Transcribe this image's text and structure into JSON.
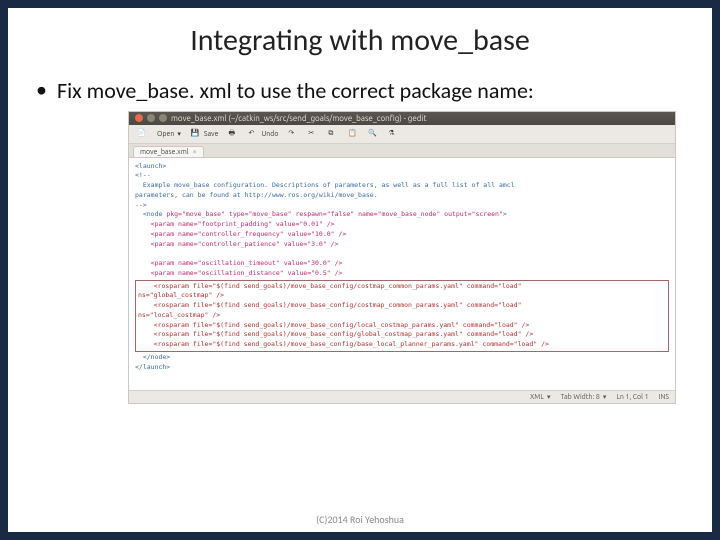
{
  "title": "Integrating with move_base",
  "bullet": "Fix move_base. xml to use the correct package name:",
  "footer": "(C)2014 Roi Yehoshua",
  "window": {
    "title": "move_base.xml (~/catkin_ws/src/send_goals/move_base_config) - gedit",
    "tab": "move_base.xml",
    "tab_close": "×"
  },
  "toolbar": {
    "open": "Open",
    "save": "Save",
    "undo": "Undo"
  },
  "code": {
    "l1a": "<launch>",
    "l2a": "<!--",
    "l2b": "Example move_base configuration. Descriptions of parameters, as well as a full list of all amcl",
    "l2c": "parameters, can be found at http://www.ros.org/wiki/move_base.",
    "l2d": "-->",
    "l3_open": "<node ",
    "l3_attrs": "pkg=\"move_base\" type=\"move_base\" respawn=\"false\" name=\"move_base_node\" output=\"screen\"",
    "l3_close": ">",
    "p1": "<param name=\"footprint_padding\" value=\"0.01\" />",
    "p2": "<param name=\"controller_frequency\" value=\"10.0\" />",
    "p3": "<param name=\"controller_patience\" value=\"3.0\" />",
    "p4": "<param name=\"oscillation_timeout\" value=\"30.0\" />",
    "p5": "<param name=\"oscillation_distance\" value=\"0.5\" />",
    "h1": "<rosparam file=\"$(find send_goals)/move_base_config/costmap_common_params.yaml\" command=\"load\"",
    "h1b": "ns=\"global_costmap\" />",
    "h2": "<rosparam file=\"$(find send_goals)/move_base_config/costmap_common_params.yaml\" command=\"load\"",
    "h2b": "ns=\"local_costmap\" />",
    "h3": "<rosparam file=\"$(find send_goals)/move_base_config/local_costmap_params.yaml\" command=\"load\" />",
    "h4": "<rosparam file=\"$(find send_goals)/move_base_config/global_costmap_params.yaml\" command=\"load\" />",
    "h5": "<rosparam file=\"$(find send_goals)/move_base_config/base_local_planner_params.yaml\" command=\"load\" />",
    "l_end1": "</node>",
    "l_end2": "</launch>"
  },
  "statusbar": {
    "lang": "XML",
    "tabwidth": "Tab Width: 8",
    "pos": "Ln 1, Col 1",
    "ins": "INS"
  },
  "icons": {
    "doc": "📄",
    "open_tri": "▾",
    "save": "💾",
    "print": "🖶",
    "undo_arrow": "↶",
    "redo": "↷",
    "cut": "✂",
    "copy": "⧉",
    "paste": "📋",
    "find": "🔍",
    "replace": "⚗"
  }
}
